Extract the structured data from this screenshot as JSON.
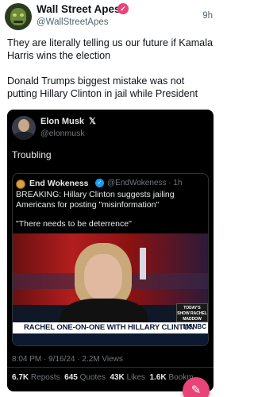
{
  "post": {
    "author_name": "Wall Street Apes",
    "author_handle": "@WallStreetApes",
    "time": "9h",
    "paragraphs": [
      "They are literally telling us our future if Kamala Harris wins the election",
      "Donald Trumps biggest mistake was not putting Hillary Clinton in jail while President"
    ]
  },
  "embedded": {
    "author_name": "Elon Musk",
    "x_mark": "𝕏",
    "author_handle": "@elonmusk",
    "text": "Troubling",
    "quote": {
      "author_name": "End Wokeness",
      "author_handle": "@EndWokeness · 1h",
      "paragraphs": [
        "BREAKING: Hillary Clinton suggests jailing Americans for posting \"misinformation\"",
        "\"There needs to be deterrence\""
      ],
      "video_lower_third": "RACHEL ONE-ON-ONE WITH HILLARY CLINTON",
      "video_logo": "TODAY'S SHOW RACHEL MADDOW",
      "video_network": "MSNBC"
    },
    "meta": "8:04 PM · 9/16/24 · 2.2M Views",
    "stats": {
      "reposts_value": "6.7K",
      "reposts_label": "Reposts",
      "quotes_value": "645",
      "quotes_label": "Quotes",
      "likes_value": "43K",
      "likes_label": "Likes",
      "bookmarks_value": "1.6K",
      "bookmarks_label": "Bookm"
    }
  },
  "fab_icon": "compose-icon",
  "colors": {
    "accent": "#e8447a",
    "verified_blue": "#1d9bf0",
    "embed_bg": "#000000"
  }
}
